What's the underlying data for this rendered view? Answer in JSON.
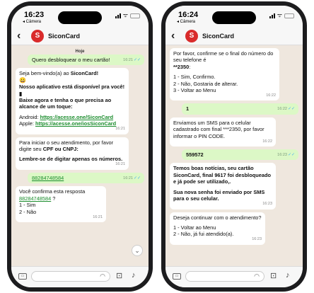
{
  "left": {
    "time": "16:23",
    "camera_back": "◂ Câmera",
    "contact": "SiconCard",
    "avatar_letter": "S",
    "date_chip": "Hoje",
    "m1": {
      "text": "Quero desbloquear o meu cartão!",
      "time": "16:21",
      "status": "✓✓"
    },
    "m2": {
      "l1a": "Seja bem-vindo(a) ao ",
      "l1b": "SiconCard!",
      "emoji": "😀",
      "l2": "Nosso aplicativo está disponível pra você! ▮",
      "l3": "Baixe agora e tenha o que precisa ao alcance de um toque:",
      "android_label": "Android: ",
      "android_link": "https://acesse.one/SiconCard",
      "apple_label": "Apple: ",
      "apple_link": "https://acesse.one/iosSiconCard",
      "time": "16:21"
    },
    "m3": {
      "l1a": "Para iniciar o seu atendimento, por favor digite seu ",
      "l1b": "CPF ou CNPJ:",
      "l2": "Lembre-se de digitar apenas os números.",
      "time": "16:21"
    },
    "m4": {
      "text": "88284748584",
      "time": "16:21",
      "status": "✓✓"
    },
    "m5": {
      "l1": "Você confirma esta resposta",
      "link": "88284748584",
      "q": " ?",
      "l2": "1 - Sim",
      "l3": "2 - Não",
      "time": "16:21"
    },
    "scroll_icon": "⌄"
  },
  "right": {
    "time": "16:24",
    "camera_back": "◂ Câmera",
    "contact": "SiconCard",
    "avatar_letter": "S",
    "m1": {
      "l1": "Por favor, confirme se o final do número do seu telefone é",
      "l2": "**2350",
      "colon": ":",
      "o1": "1 - Sim, Confirmo.",
      "o2": "2 - Não, Gostaria de alterar.",
      "o3": "3 - Voltar ao Menu",
      "time": "16:22"
    },
    "m2": {
      "text": "1",
      "time": "16:22",
      "status": "✓✓"
    },
    "m3": {
      "text": "Enviamos um SMS para o celular cadastrado com final ***2350, por favor informar o PIN CODE.",
      "time": "16:22"
    },
    "m4": {
      "text": "559572",
      "time": "16:23",
      "status": "✓✓"
    },
    "m5": {
      "l1": "Temos boas notícias, seu cartão SiconCard, final 9617 foi desbloqueado e já pode ser utilizado,.",
      "l2": "Sua nova senha foi enviado por SMS para o seu celular.",
      "time": "16:23"
    },
    "m6": {
      "l1": "Deseja continuar com o atendimento?",
      "o1": "1 - Voltar ao Menu",
      "o2": "2 - Não, já fui atendido(a).",
      "time": "16:23"
    }
  },
  "icons": {
    "back": "‹",
    "wifi": "ᯤ",
    "keyboard": "⌨",
    "camera": "⊡",
    "mic": "♪",
    "sticker": "◠"
  }
}
